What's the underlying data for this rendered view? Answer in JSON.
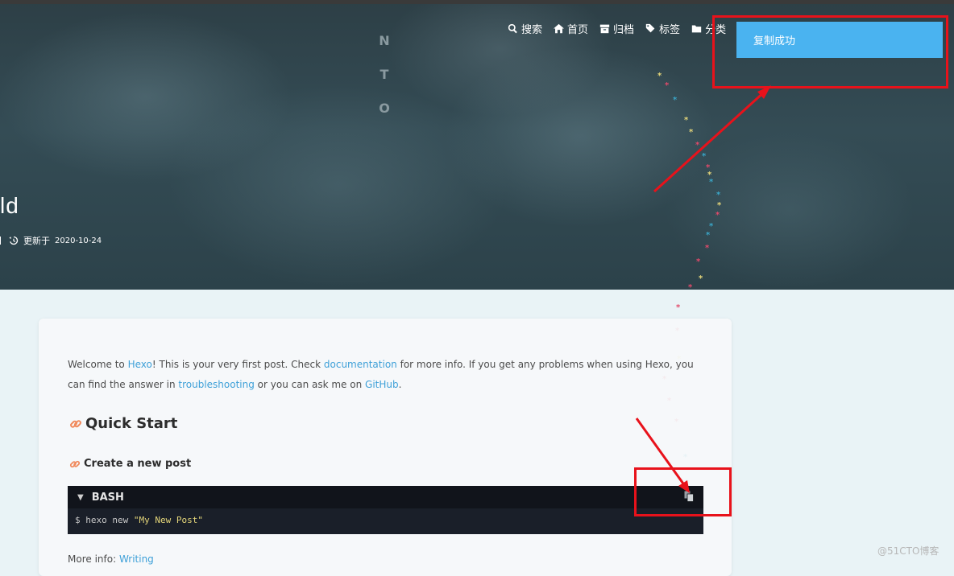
{
  "brand": {
    "letters": [
      "N",
      "T",
      "O"
    ]
  },
  "nav": {
    "items": [
      {
        "label": "搜索",
        "icon": "search-icon"
      },
      {
        "label": "首页",
        "icon": "home-icon"
      },
      {
        "label": "归档",
        "icon": "archive-icon"
      },
      {
        "label": "标签",
        "icon": "tags-icon"
      },
      {
        "label": "分类",
        "icon": "folder-icon"
      }
    ]
  },
  "post": {
    "title_visible": "ld",
    "updated_label": "更新于",
    "updated_date": "2020-10-24"
  },
  "toast": {
    "text": "复制成功"
  },
  "content": {
    "intro": {
      "t1": "Welcome to ",
      "link_hexo": "Hexo",
      "t2": "! This is your very first post. Check ",
      "link_docs": "documentation",
      "t3": " for more info. If you get any problems when using Hexo, you can find the answer in ",
      "link_troubleshooting": "troubleshooting",
      "t4": " or you can ask me on ",
      "link_github": "GitHub",
      "t5": "."
    },
    "h2": "Quick Start",
    "h3": "Create a new post",
    "code": {
      "lang": "BASH",
      "prompt": "$ hexo new ",
      "arg": "\"My New Post\""
    },
    "more_info": {
      "label": "More info: ",
      "link": "Writing"
    }
  },
  "watermark": "@51CTO博客",
  "colors": {
    "toast": "#4ab3f0",
    "annotation_red": "#e8121b",
    "link": "#3ea0d8",
    "code_bg": "#1a1f29"
  }
}
